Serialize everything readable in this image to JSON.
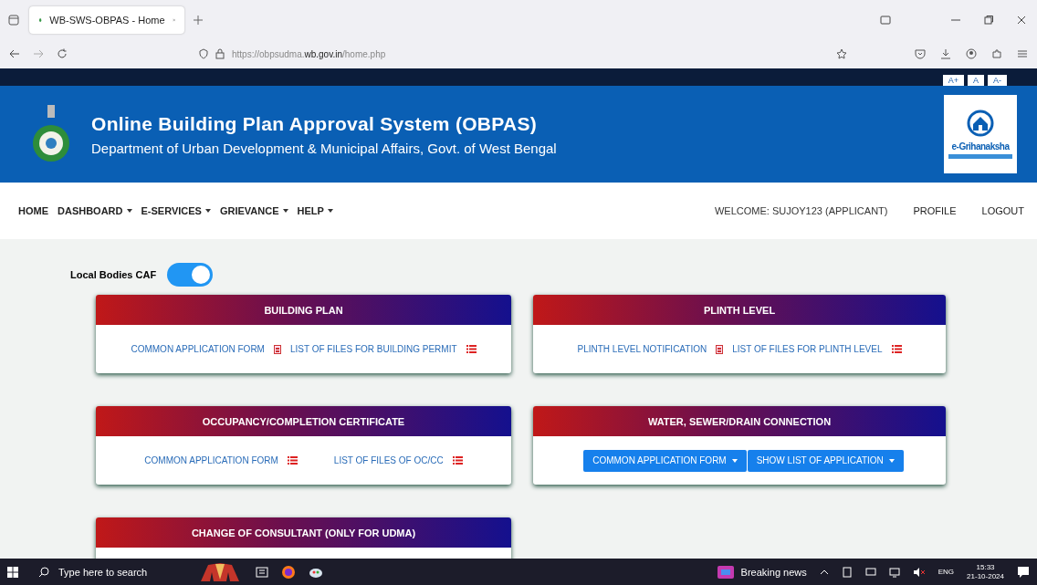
{
  "browser": {
    "tab_title": "WB-SWS-OBPAS - Home",
    "url_prefix": "https://obpsudma.",
    "url_domain": "wb.gov.in",
    "url_path": "/home.php"
  },
  "font_size_buttons": [
    "A+",
    "A",
    "A-"
  ],
  "header": {
    "title": "Online Building Plan Approval System (OBPAS)",
    "subtitle": "Department of Urban Development & Municipal Affairs, Govt. of West Bengal",
    "logo_text": "e-Grihanaksha"
  },
  "nav": {
    "items": [
      {
        "label": "HOME",
        "dropdown": false
      },
      {
        "label": "DASHBOARD",
        "dropdown": true
      },
      {
        "label": "E-SERVICES",
        "dropdown": true
      },
      {
        "label": "GRIEVANCE",
        "dropdown": true
      },
      {
        "label": "HELP",
        "dropdown": true
      }
    ],
    "right": [
      "WELCOME: SUJOY123 (APPLICANT)",
      "PROFILE",
      "LOGOUT"
    ]
  },
  "toggle": {
    "label": "Local Bodies CAF",
    "on": true
  },
  "cards": [
    {
      "title": "BUILDING PLAN",
      "kind": "links",
      "links": [
        {
          "label": "COMMON APPLICATION FORM",
          "kind": "document"
        },
        {
          "label": "LIST OF FILES FOR BUILDING PERMIT",
          "kind": "list"
        }
      ]
    },
    {
      "title": "PLINTH LEVEL",
      "kind": "links",
      "links": [
        {
          "label": "PLINTH LEVEL NOTIFICATION",
          "kind": "document"
        },
        {
          "label": "LIST OF FILES FOR PLINTH LEVEL",
          "kind": "list"
        }
      ]
    },
    {
      "title": "OCCUPANCY/COMPLETION CERTIFICATE",
      "kind": "links",
      "links": [
        {
          "label": "COMMON APPLICATION FORM",
          "kind": "list"
        },
        {
          "label": "LIST OF FILES OF OC/CC",
          "kind": "list"
        }
      ]
    },
    {
      "title": "WATER, SEWER/DRAIN CONNECTION",
      "kind": "dropdowns",
      "links": [
        {
          "label": "COMMON APPLICATION FORM",
          "kind": "dropdown"
        },
        {
          "label": "SHOW LIST OF APPLICATION",
          "kind": "dropdown"
        }
      ]
    },
    {
      "title": "CHANGE OF CONSULTANT (ONLY FOR UDMA)",
      "kind": "links"
    }
  ],
  "taskbar": {
    "search_placeholder": "Type here to search",
    "news": "Breaking news",
    "lang": "ENG",
    "time": "15:33",
    "date": "21-10-2024"
  }
}
